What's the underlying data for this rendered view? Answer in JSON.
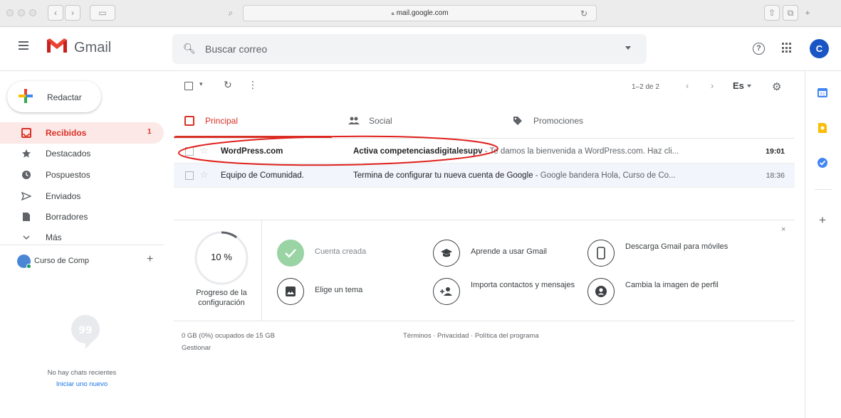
{
  "browser": {
    "url": "mail.google.com"
  },
  "header": {
    "app_name": "Gmail",
    "search_placeholder": "Buscar correo",
    "avatar_letter": "C"
  },
  "sidebar": {
    "compose_label": "Redactar",
    "items": [
      {
        "label": "Recibidos",
        "count": "1",
        "icon": "inbox-icon",
        "active": true
      },
      {
        "label": "Destacados",
        "icon": "star-icon"
      },
      {
        "label": "Pospuestos",
        "icon": "clock-icon"
      },
      {
        "label": "Enviados",
        "icon": "send-icon"
      },
      {
        "label": "Borradores",
        "icon": "draft-icon"
      },
      {
        "label": "Más",
        "icon": "chevron-down-icon"
      }
    ],
    "hangouts_user": "Curso de Comp",
    "no_chats_text": "No hay chats recientes",
    "start_new_link": "Iniciar uno nuevo"
  },
  "toolbar": {
    "pagination": "1–2 de 2",
    "language": "Es"
  },
  "tabs": [
    {
      "label": "Principal",
      "icon": "inbox-icon",
      "active": true
    },
    {
      "label": "Social",
      "icon": "people-icon"
    },
    {
      "label": "Promociones",
      "icon": "tag-icon"
    }
  ],
  "emails": [
    {
      "sender": "WordPress.com",
      "subject": "Activa competenciasdigitalesupv",
      "snippet": " - Te damos la bienvenida a WordPress.com. Haz cli...",
      "time": "19:01",
      "unread": true
    },
    {
      "sender": "Equipo de Comunidad.",
      "subject": "Termina de configurar tu nueva cuenta de Google",
      "snippet": " - Google bandera Hola, Curso de Co...",
      "time": "18:36",
      "unread": false
    }
  ],
  "setup": {
    "progress_value": "10 %",
    "progress_fraction": 0.1,
    "progress_label": "Progreso de la configuración",
    "close": "×",
    "steps": [
      {
        "label": "Cuenta creada",
        "icon": "check-icon",
        "done": true
      },
      {
        "label": "Aprende a usar Gmail",
        "icon": "graduation-cap-icon"
      },
      {
        "label": "Descarga Gmail para móviles",
        "icon": "phone-icon"
      },
      {
        "label": "Elige un tema",
        "icon": "image-icon"
      },
      {
        "label": "Importa contactos y mensajes",
        "icon": "add-contact-icon"
      },
      {
        "label": "Cambia la imagen de perfil",
        "icon": "account-icon"
      }
    ]
  },
  "footer": {
    "storage": "0 GB (0%) ocupados de 15 GB",
    "manage": "Gestionar",
    "terms": "Términos · Privacidad · Política del programa"
  },
  "colors": {
    "accent_red": "#d93025",
    "avatar_blue": "#1a55c6",
    "annotation_red": "#e0201c"
  }
}
